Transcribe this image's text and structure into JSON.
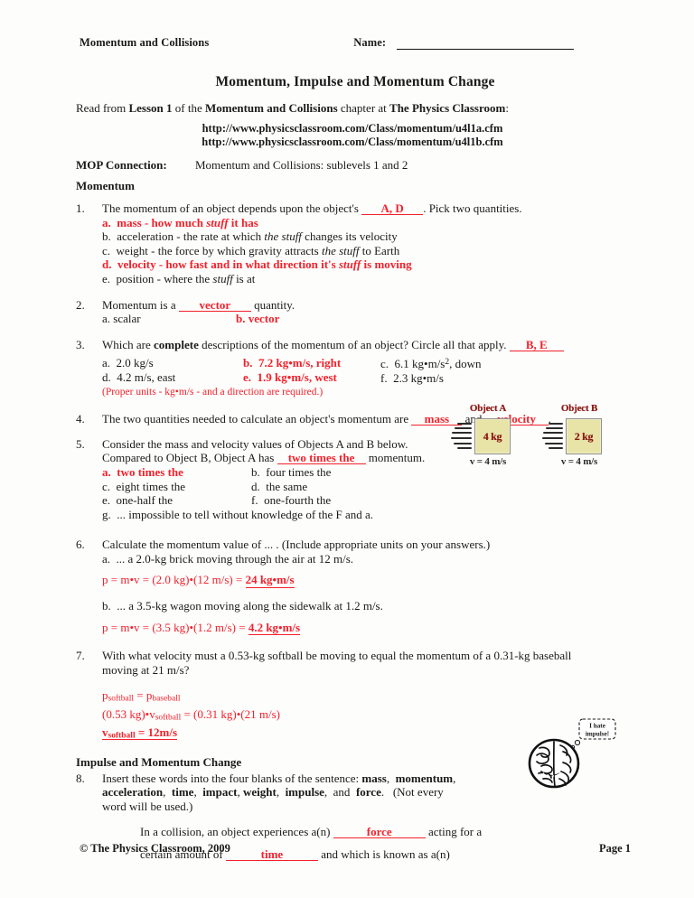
{
  "header": {
    "left_title": "Momentum and Collisions",
    "name_label": "Name:"
  },
  "doc_title": "Momentum, Impulse and Momentum Change",
  "read_from": {
    "pre": "Read from ",
    "lesson": "Lesson 1",
    "mid": " of the ",
    "chapter": "Momentum and Collisions",
    "mid2": " chapter at ",
    "site": "The Physics Classroom",
    "post": ":"
  },
  "urls": [
    "http://www.physicsclassroom.com/Class/momentum/u4l1a.cfm",
    "http://www.physicsclassroom.com/Class/momentum/u4l1b.cfm"
  ],
  "mop": {
    "label": "MOP Connection:",
    "value": "Momentum and Collisions:  sublevels 1 and 2"
  },
  "sections": {
    "momentum": "Momentum",
    "impulse": "Impulse and Momentum Change"
  },
  "q1": {
    "num": "1.",
    "stem_pre": "The momentum of an object depends upon the object's ",
    "answer": "A, D",
    "stem_post": ".  Pick two quantities.",
    "options": [
      {
        "letter": "a.",
        "text_pre": "mass - how much ",
        "italic": "stuff",
        "text_post": " it has",
        "red": true
      },
      {
        "letter": "b.",
        "text_pre": "acceleration - the rate at which ",
        "italic": "the stuff",
        "text_post": " changes its velocity",
        "red": false
      },
      {
        "letter": "c.",
        "text_pre": "weight - the force by which gravity attracts ",
        "italic": "the stuff",
        "text_post": " to Earth",
        "red": false
      },
      {
        "letter": "d.",
        "text_pre": "velocity - how fast and in what direction it's ",
        "italic": "stuff",
        "text_post": " is moving",
        "red": true
      },
      {
        "letter": "e.",
        "text_pre": "position - where the ",
        "italic": "stuff",
        "text_post": " is at",
        "red": false
      }
    ]
  },
  "q2": {
    "num": "2.",
    "stem_pre": "Momentum is a ",
    "answer": "vector",
    "stem_post": " quantity.",
    "opt_a": "a.  scalar",
    "opt_b": "b.  vector"
  },
  "q3": {
    "num": "3.",
    "stem_pre": "Which are ",
    "bold": "complete",
    "stem_mid": " descriptions of the momentum of an object?  Circle all that apply.  ",
    "answer": "B, E",
    "col1": [
      {
        "letter": "a.",
        "text": "2.0 kg/s",
        "red": false
      },
      {
        "letter": "d.",
        "text": "4.2 m/s, east",
        "red": false
      }
    ],
    "col2": [
      {
        "letter": "b.",
        "text": "7.2 kg•m/s, right",
        "red": true
      },
      {
        "letter": "e.",
        "text": "1.9 kg•m/s, west",
        "red": true
      }
    ],
    "col3": [
      {
        "letter": "c.",
        "text_pre": "6.1 kg•m/s",
        "sup": "2",
        "text_post": ", down",
        "red": false
      },
      {
        "letter": "f.",
        "text_pre": "2.3 kg•m/s",
        "sup": "",
        "text_post": "",
        "red": false
      }
    ],
    "note": "(Proper units - kg•m/s - and a direction are required.)"
  },
  "q4": {
    "num": "4.",
    "stem_pre": "The two quantities needed to calculate an object's momentum are ",
    "answer1": "mass",
    "stem_mid": " and ",
    "answer2": "velocity",
    "stem_post": "."
  },
  "q5": {
    "num": "5.",
    "line1": "Consider the mass and velocity values of Objects A and B below.",
    "line2_pre": "Compared to Object B, Object A has ",
    "answer": "two times the",
    "line2_post": " momentum.",
    "col1": [
      {
        "letter": "a.",
        "text": "two times the",
        "red": true
      },
      {
        "letter": "c.",
        "text": "eight times the",
        "red": false
      },
      {
        "letter": "e.",
        "text": "one-half the",
        "red": false
      }
    ],
    "col2": [
      {
        "letter": "b.",
        "text": "four times the",
        "red": false
      },
      {
        "letter": "d.",
        "text": "the same",
        "red": false
      },
      {
        "letter": "f.",
        "text": "one-fourth the",
        "red": false
      }
    ],
    "last": {
      "letter": "g.",
      "text": "... impossible to tell without knowledge of the F and a."
    },
    "figure": {
      "objects": [
        {
          "name": "Object A",
          "mass": "4 kg",
          "velocity": "v = 4 m/s"
        },
        {
          "name": "Object B",
          "mass": "2 kg",
          "velocity": "v = 4 m/s"
        }
      ]
    }
  },
  "q6": {
    "num": "6.",
    "stem": "Calculate the momentum value of ... .  (Include appropriate units on your answers.)",
    "parts": [
      {
        "letter": "a.",
        "text": "... a 2.0-kg brick moving through the air at 12 m/s.",
        "work_pre": "p = m•v = (2.0 kg)•(12 m/s) = ",
        "answer": "24 kg•m/s"
      },
      {
        "letter": "b.",
        "text": "... a 3.5-kg wagon moving along the sidewalk at 1.2 m/s.",
        "work_pre": "p = m•v = (3.5 kg)•(1.2 m/s) = ",
        "answer": "4.2 kg•m/s"
      }
    ]
  },
  "q7": {
    "num": "7.",
    "line1": "With what velocity must a 0.53-kg softball be moving to equal the momentum of a 0.31-kg baseball",
    "line2": "moving at 21 m/s?",
    "work": {
      "l1_a": "p",
      "l1_sub_a": "softball",
      "l1_eq": " = ",
      "l1_b": "p",
      "l1_sub_b": "baseball",
      "l2_pre": "(0.53 kg)•v",
      "l2_sub": "softball",
      "l2_post": " = (0.31 kg)•(21 m/s)",
      "l3_pre": "v",
      "l3_sub": "softball",
      "l3_post": " = 12m/s"
    }
  },
  "q8": {
    "num": "8.",
    "line1_pre": "Insert these words into the four blanks of the sentence:   ",
    "words_line1": [
      "mass",
      "momentum"
    ],
    "words_line2": [
      "acceleration",
      "time",
      "impact",
      "weight",
      "impulse"
    ],
    "and_word": "force",
    "note": "(Not every",
    "line3": "word will be used.)",
    "fill1_pre": "In a collision, an object experiences a(n) ",
    "fill1_answer": "force",
    "fill1_post": " acting for a",
    "fill2_pre": "certain amount of ",
    "fill2_answer": "time",
    "fill2_post": " and which is known as a(n)",
    "cartoon_text_line1": "I hate",
    "cartoon_text_line2": "impulse!"
  },
  "footer": {
    "copyright": "©  The Physics Classroom, 2009",
    "page": "Page 1"
  },
  "colors": {
    "answer_red": "#f4212b",
    "figure_dark_red": "#8d1a16",
    "box_fill": "#e8e4a8",
    "text": "#1a1a1a"
  }
}
